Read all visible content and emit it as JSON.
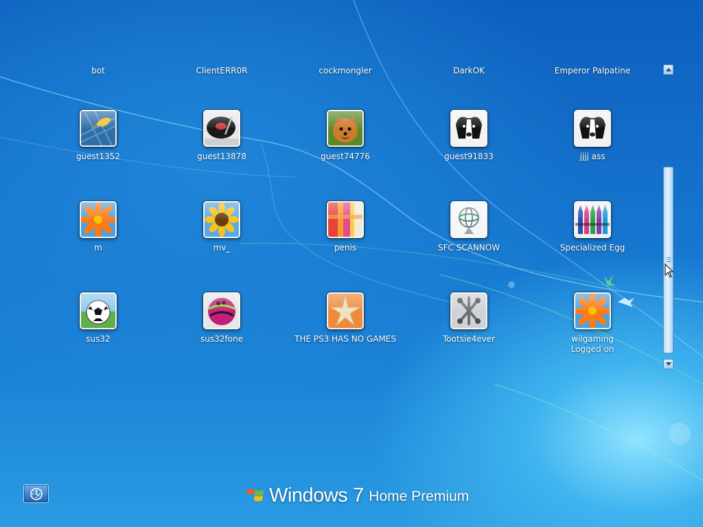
{
  "top_row_names": [
    "bot",
    "ClientERR0R",
    "cockmongler",
    "DarkOK",
    "Emperor Palpatine"
  ],
  "users": [
    {
      "name": "guest1352",
      "picture": "leaf-icon"
    },
    {
      "name": "guest13878",
      "picture": "turntable-icon"
    },
    {
      "name": "guest74776",
      "picture": "pomeranian-dog-icon"
    },
    {
      "name": "guest91833",
      "picture": "border-collie-icon"
    },
    {
      "name": "jjjj ass",
      "picture": "border-collie-icon"
    },
    {
      "name": "m",
      "picture": "orange-daisy-icon"
    },
    {
      "name": "mv_",
      "picture": "sunflower-icon"
    },
    {
      "name": "penis",
      "picture": "colored-stripes-icon"
    },
    {
      "name": "SFC SCANNOW",
      "picture": "gyroscope-icon"
    },
    {
      "name": "Specialized Egg",
      "picture": "crayons-icon"
    },
    {
      "name": "sus32",
      "picture": "soccer-ball-icon"
    },
    {
      "name": "sus32fone",
      "picture": "bowling-ball-icon"
    },
    {
      "name": "THE PS3 HAS NO GAMES",
      "picture": "starfish-icon"
    },
    {
      "name": "Tootsie4ever",
      "picture": "jacks-icon"
    },
    {
      "name": "wilgaming",
      "status": "Logged on",
      "picture": "orange-daisy-icon"
    }
  ],
  "branding": {
    "windows": "Windows",
    "version": "7",
    "edition": "Home Premium"
  },
  "ease_of_access": {
    "icon": "ease-of-access-icon"
  },
  "scrollbar": {
    "up_icon": "scroll-up-arrow-icon",
    "down_icon": "scroll-down-arrow-icon"
  },
  "colors": {
    "background": "#1676cf",
    "text": "#ffffff"
  }
}
